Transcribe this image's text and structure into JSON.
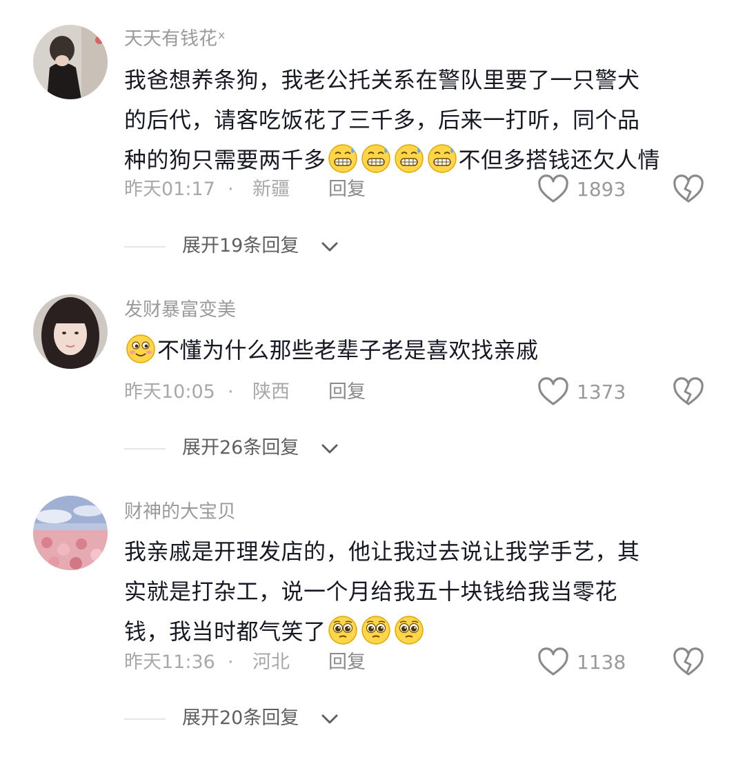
{
  "comments": [
    {
      "username": "天天有钱花ˣ",
      "lines": [
        [
          {
            "t": "text",
            "v": "我爸想养条狗，我老公托关系在警队里要了一只警犬"
          }
        ],
        [
          {
            "t": "text",
            "v": "的后代，请客吃饭花了三千多，后来一打听，同个品"
          }
        ],
        [
          {
            "t": "text",
            "v": "种的狗只需要两千多"
          },
          {
            "t": "emoji",
            "v": "grin-sweat"
          },
          {
            "t": "emoji",
            "v": "grin-sweat"
          },
          {
            "t": "emoji",
            "v": "grin-sweat"
          },
          {
            "t": "emoji",
            "v": "grin-sweat"
          },
          {
            "t": "text",
            "v": "不但多搭钱还欠人情"
          }
        ]
      ],
      "time": "昨天01:17",
      "dot": "·",
      "location": "新疆",
      "reply_label": "回复",
      "like_count": "1893",
      "expand_label": "展开19条回复"
    },
    {
      "username": "发财暴富变美",
      "lines": [
        [
          {
            "t": "emoji",
            "v": "smile-blush"
          },
          {
            "t": "text",
            "v": "不懂为什么那些老辈子老是喜欢找亲戚"
          }
        ]
      ],
      "time": "昨天10:05",
      "dot": "·",
      "location": "陕西",
      "reply_label": "回复",
      "like_count": "1373",
      "expand_label": "展开26条回复"
    },
    {
      "username": "财神的大宝贝",
      "lines": [
        [
          {
            "t": "text",
            "v": "我亲戚是开理发店的，他让我过去说让我学手艺，其"
          }
        ],
        [
          {
            "t": "text",
            "v": "实就是打杂工，说一个月给我五十块钱给我当零花"
          }
        ],
        [
          {
            "t": "text",
            "v": "钱，我当时都气笑了"
          },
          {
            "t": "emoji",
            "v": "pleading"
          },
          {
            "t": "emoji",
            "v": "pleading"
          },
          {
            "t": "emoji",
            "v": "pleading"
          }
        ]
      ],
      "time": "昨天11:36",
      "dot": "·",
      "location": "河北",
      "reply_label": "回复",
      "like_count": "1138",
      "expand_label": "展开20条回复"
    }
  ],
  "icons": {
    "like": "heart-outline-icon",
    "dislike": "broken-heart-icon",
    "expand": "chevron-down-icon"
  },
  "colors": {
    "text": "#161823",
    "username": "#9a9a9a",
    "meta": "#a8a8a8",
    "icon": "#8a8a8a"
  }
}
